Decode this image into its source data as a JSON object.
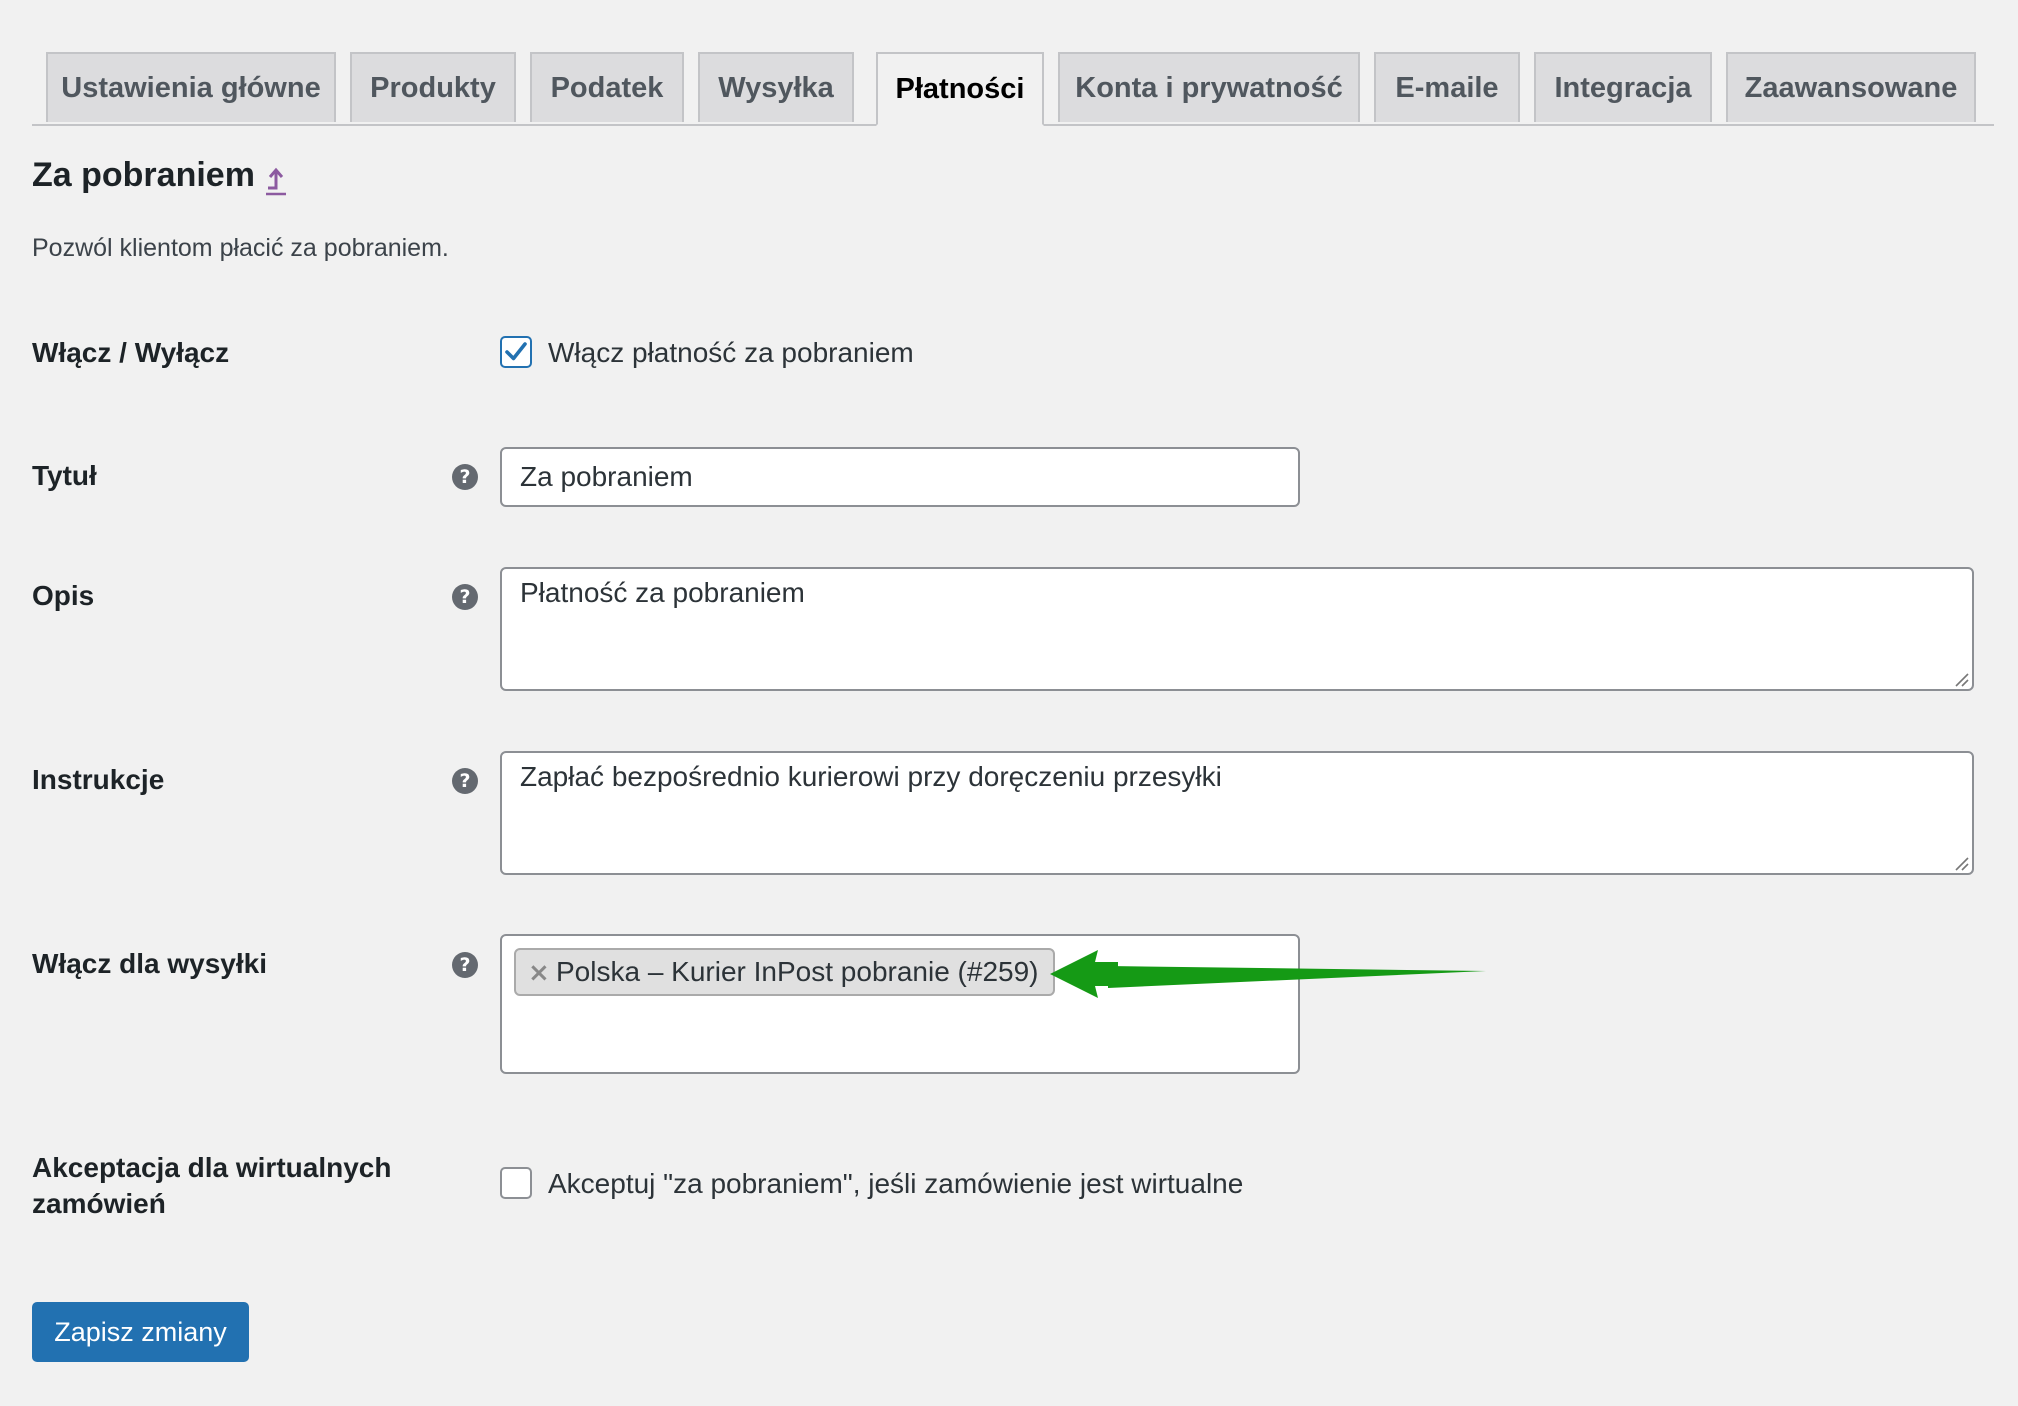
{
  "tabs": [
    {
      "label": "Ustawienia główne",
      "active": false
    },
    {
      "label": "Produkty",
      "active": false
    },
    {
      "label": "Podatek",
      "active": false
    },
    {
      "label": "Wysyłka",
      "active": false
    },
    {
      "label": "Płatności",
      "active": true
    },
    {
      "label": "Konta i prywatność",
      "active": false
    },
    {
      "label": "E-maile",
      "active": false
    },
    {
      "label": "Integracja",
      "active": false
    },
    {
      "label": "Zaawansowane",
      "active": false
    }
  ],
  "header": {
    "title": "Za pobraniem",
    "up_icon": "up-arrow-icon",
    "description": "Pozwól klientom płacić za pobraniem."
  },
  "fields": {
    "enable": {
      "label": "Włącz / Wyłącz",
      "checkbox_label": "Włącz płatność za pobraniem",
      "checked": true
    },
    "title": {
      "label": "Tytuł",
      "value": "Za pobraniem",
      "help_icon": "?"
    },
    "description": {
      "label": "Opis",
      "value": "Płatność za pobraniem",
      "help_icon": "?"
    },
    "instructions": {
      "label": "Instrukcje",
      "value": "Zapłać bezpośrednio kurierowi przy doręczeniu przesyłki",
      "help_icon": "?"
    },
    "shipping": {
      "label": "Włącz dla wysyłki",
      "help_icon": "?",
      "selected": [
        {
          "label": "Polska – Kurier InPost pobranie (#259)",
          "remove": "×"
        }
      ]
    },
    "virtual": {
      "label_line1": "Akceptacja dla wirtualnych",
      "label_line2": "zamówień",
      "checkbox_label": "Akceptuj \"za pobraniem\", jeśli zamówienie jest wirtualne",
      "checked": false
    }
  },
  "actions": {
    "save_label": "Zapisz zmiany"
  },
  "colors": {
    "accent": "#2271b1",
    "annotation_arrow": "#159a15",
    "background": "#f1f1f1"
  }
}
